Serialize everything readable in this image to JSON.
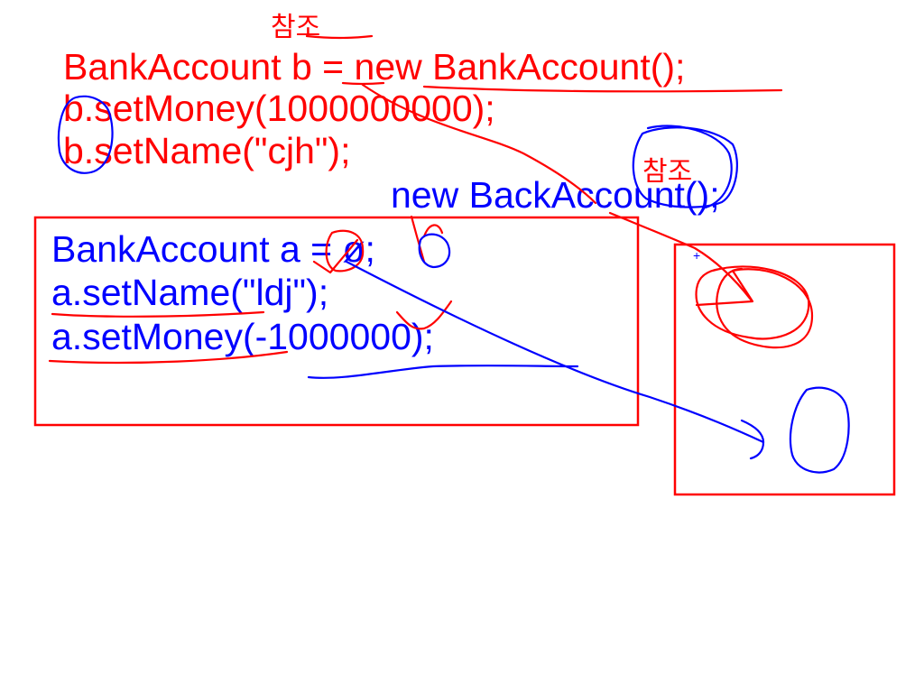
{
  "colors": {
    "red": "#ff0000",
    "blue": "#0000ff",
    "background": "#ffffff"
  },
  "whiteboard": {
    "red_code": {
      "line1": "BankAccount b = new BankAccount();",
      "line2": "b.setMoney(1000000000);",
      "line3": "b.setName(\"cjh\");"
    },
    "blue_new_expression": "new BackAccount();",
    "boxed_code": {
      "line1": "BankAccount a = ø;",
      "line2": "a.setName(\"ldj\");",
      "line3": "a.setMoney(-1000000);"
    },
    "annotations": {
      "top_note": "참조",
      "blue_note": "참조"
    },
    "cursor": "+"
  }
}
